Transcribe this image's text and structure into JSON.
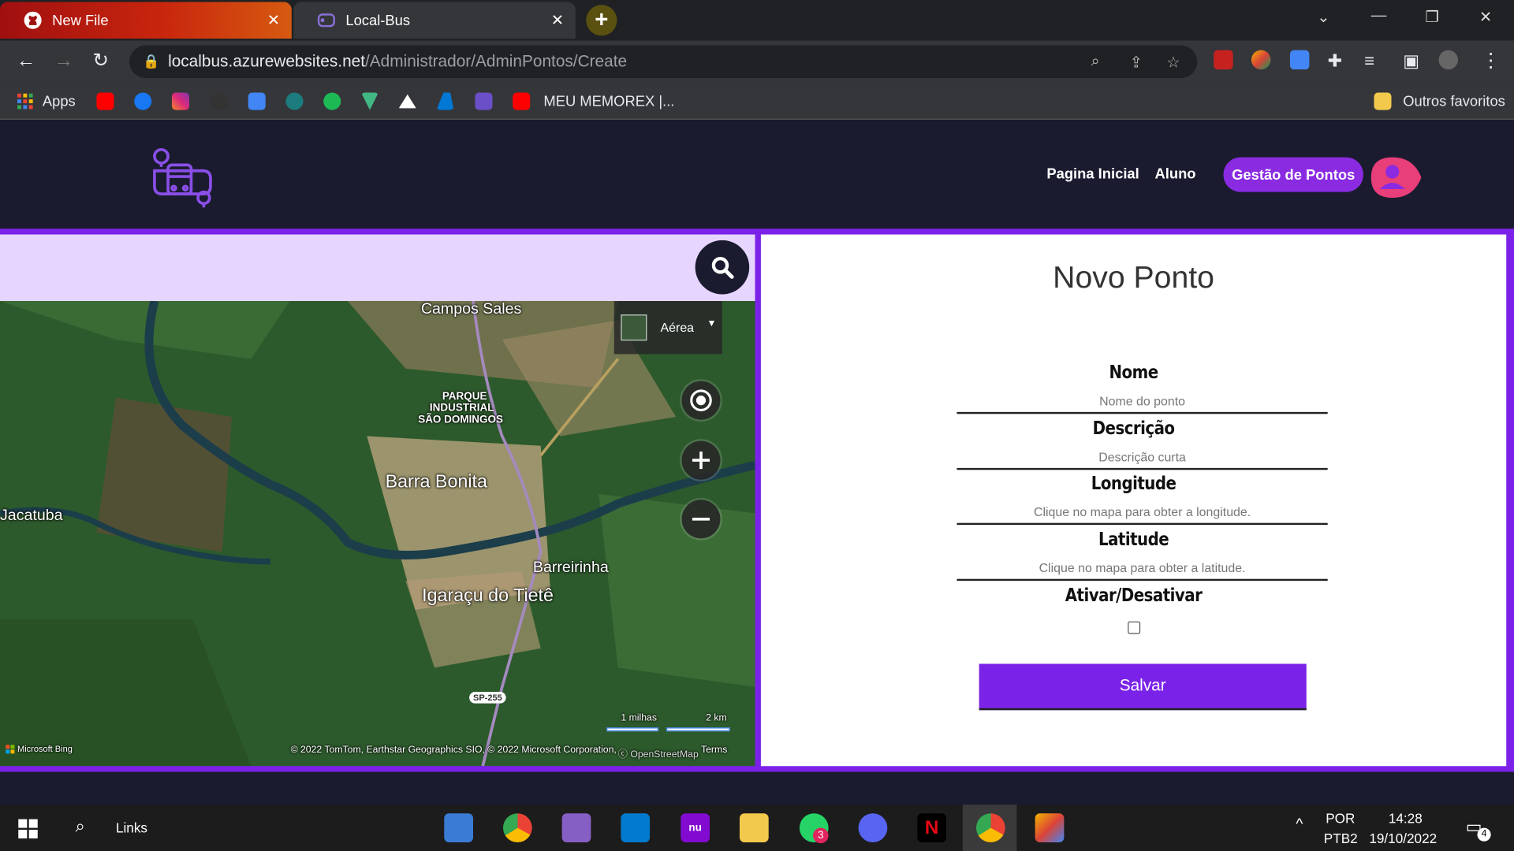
{
  "browser": {
    "tabs": [
      {
        "title": "New File",
        "icon": "github-icon"
      },
      {
        "title": "Local-Bus",
        "icon": "localbus-icon"
      }
    ],
    "url_host": "localbus.azurewebsites.net",
    "url_path": "/Administrador/AdminPontos/Create",
    "bookmarks": {
      "apps": "Apps",
      "memorex": "MEU MEMOREX |...",
      "outros": "Outros favoritos"
    }
  },
  "site": {
    "nav": {
      "home": "Pagina Inicial",
      "aluno": "Aluno",
      "gestao": "Gestão de Pontos"
    }
  },
  "map": {
    "type_label": "Aérea",
    "places": {
      "campos_sales": "Campos Sales",
      "parque_1": "PARQUE",
      "parque_2": "INDUSTRIAL",
      "parque_3": "SÃO DOMINGOS",
      "barra_bonita": "Barra Bonita",
      "jacatuba": "Jacatuba",
      "barreirinha": "Barreirinha",
      "igaracu": "Igaraçu do Tietê",
      "sp255": "SP-255"
    },
    "scale_miles": "1 milhas",
    "scale_km": "2 km",
    "brand": "Microsoft Bing",
    "attribution": "© 2022 TomTom, Earthstar Geographics SIO, © 2022 Microsoft Corporation,",
    "osm": "OpenStreetMap",
    "terms": "Terms"
  },
  "form": {
    "title": "Novo Ponto",
    "fields": [
      {
        "label": "Nome",
        "placeholder": "Nome do ponto"
      },
      {
        "label": "Descrição",
        "placeholder": "Descrição curta"
      },
      {
        "label": "Longitude",
        "placeholder": "Clique no mapa para obter a longitude."
      },
      {
        "label": "Latitude",
        "placeholder": "Clique no mapa para obter a latitude."
      }
    ],
    "toggle_label": "Ativar/Desativar",
    "toggle_checked": false,
    "submit": "Salvar"
  },
  "taskbar": {
    "search_label": "Links",
    "lang1": "POR",
    "lang2": "PTB2",
    "time": "14:28",
    "date": "19/10/2022",
    "whatsapp_badge": "3",
    "notif_badge": "4"
  }
}
